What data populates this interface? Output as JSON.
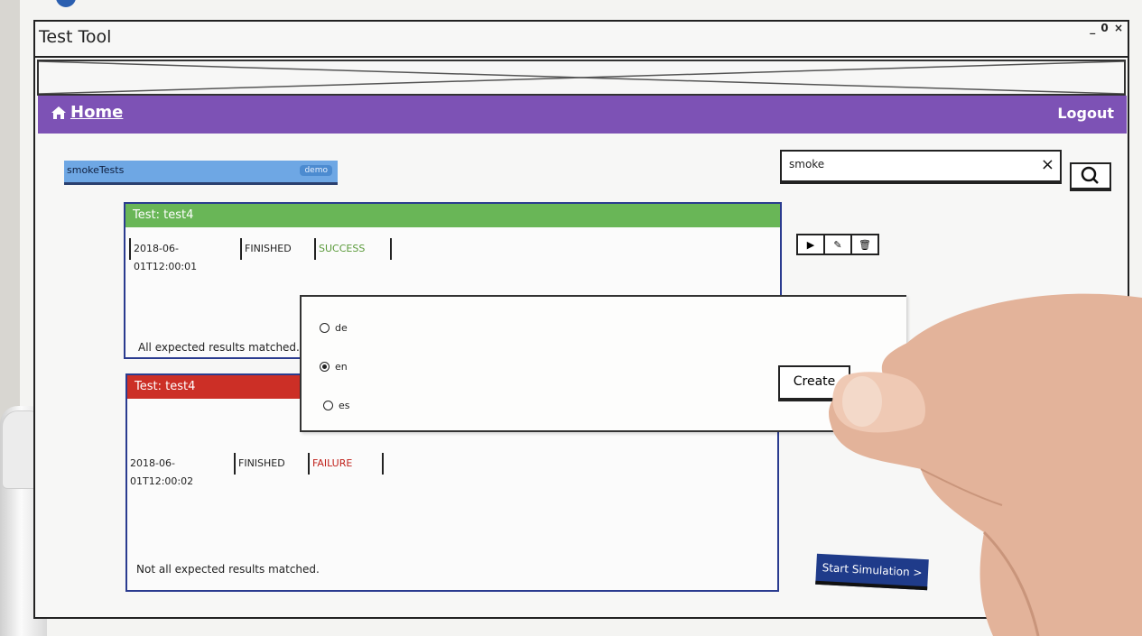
{
  "window": {
    "title": "Test Tool",
    "controls": "_ 0 ×"
  },
  "nav": {
    "home_label": "Home",
    "logout_label": "Logout"
  },
  "project": {
    "name": "smokeTests",
    "badge": "demo"
  },
  "search": {
    "value": "smoke",
    "clear_icon": "×"
  },
  "actions": [
    {
      "icon": "play-icon",
      "glyph": "▶"
    },
    {
      "icon": "edit-icon",
      "glyph": "✎"
    },
    {
      "icon": "trash-icon",
      "glyph": "🗑"
    }
  ],
  "tests": [
    {
      "title": "Test: test4",
      "timestamp": "2018-06-01T12:00:01",
      "state": "FINISHED",
      "result": "SUCCESS",
      "result_color": "#5a9a3a",
      "header_color": "#69b657",
      "message": "All expected results matched."
    },
    {
      "title": "Test: test4",
      "timestamp": "2018-06-01T12:00:02",
      "state": "FINISHED",
      "result": "FAILURE",
      "result_color": "#c0221c",
      "header_color": "#cc2f26",
      "message": "Not all expected results matched."
    }
  ],
  "dialog": {
    "languages": [
      {
        "code": "de",
        "selected": false
      },
      {
        "code": "en",
        "selected": true
      },
      {
        "code": "es",
        "selected": false
      }
    ],
    "create_label": "Create"
  },
  "start_simulation_label": "Start Simulation >",
  "colors": {
    "nav_bg": "#7d52b5",
    "project_bg": "#6ea7e4",
    "primary_button": "#1f3b8a",
    "card_border": "#2a3b8f"
  }
}
